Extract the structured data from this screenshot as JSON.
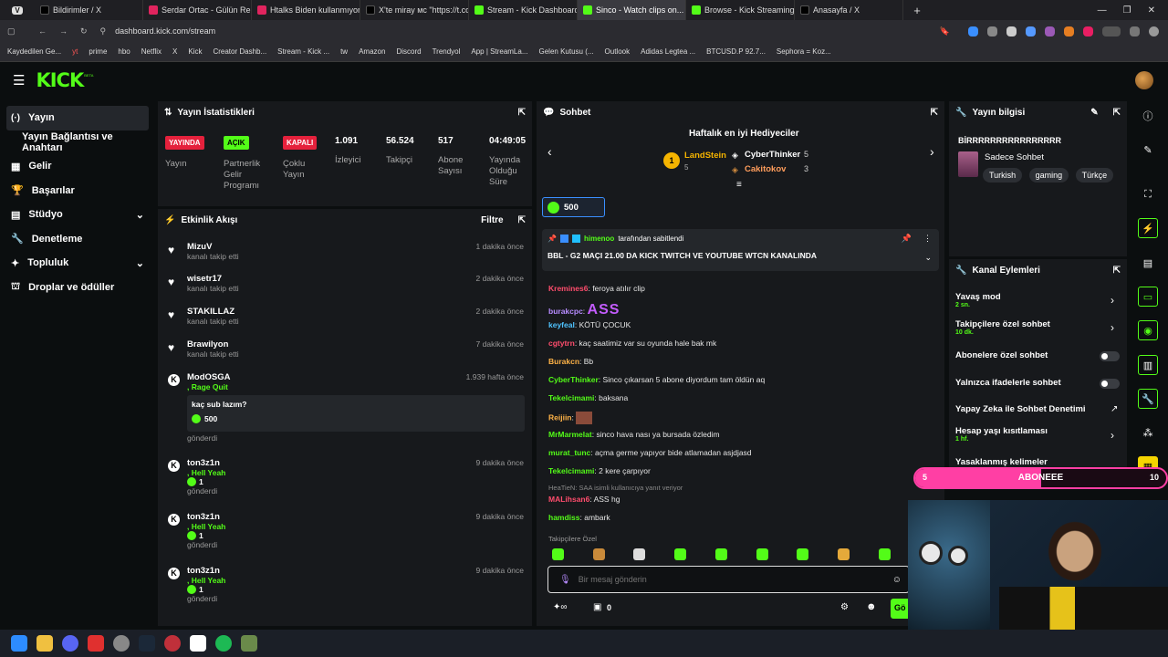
{
  "browser": {
    "tabs": [
      "Bildirimler / X",
      "Serdar Ortac - Gülün Rengi",
      "Htalks Biden kullanmıyorsa...",
      "X'te miray ᴍᴄ \"https://t.co/...",
      "Stream - Kick Dashboard",
      "Sinco - Watch clips on...",
      "Browse - Kick Streaming",
      "Anasayfa / X"
    ],
    "url": "dashboard.kick.com/stream",
    "bookmarks": [
      "Kaydedilen Ge...",
      "yt",
      "prime",
      "hbo",
      "Netflix",
      "X",
      "Kick",
      "Creator Dashb...",
      "Stream - Kick ...",
      "tw",
      "Amazon",
      "Discord",
      "Trendyol",
      "App | StreamLa...",
      "Gelen Kutusu (...",
      "Outlook",
      "Adidas Legtea ...",
      "BTCUSD.P 92.7...",
      "Sephora = Koz..."
    ]
  },
  "brand": {
    "logo": "KICK",
    "beta": "BETA"
  },
  "nav": [
    {
      "label": "Yayın",
      "icon": "broadcast-icon"
    },
    {
      "label": "Yayın Bağlantısı ve Anahtarı"
    },
    {
      "label": "Gelir",
      "icon": "grid-icon"
    },
    {
      "label": "Başarılar",
      "icon": "trophy-icon"
    },
    {
      "label": "Stüdyo",
      "icon": "studio-icon"
    },
    {
      "label": "Denetleme",
      "icon": "wrench-icon"
    },
    {
      "label": "Topluluk",
      "icon": "puzzle-icon"
    },
    {
      "label": "Droplar ve ödüller",
      "icon": "drop-icon"
    }
  ],
  "stats": {
    "title": "Yayın İstatistikleri",
    "live_badge": "YAYINDA",
    "live_label": "Yayın",
    "partner_badge": "AÇIK",
    "partner_label": "Partnerlik Gelir Programı",
    "multi_badge": "KAPALI",
    "multi_label": "Çoklu Yayın",
    "viewers": "1.091",
    "viewers_label": "İzleyici",
    "followers": "56.524",
    "followers_label": "Takipçi",
    "subs": "517",
    "subs_label": "Abone Sayısı",
    "uptime": "04:49:05",
    "uptime_label": "Yayında Olduğu Süre"
  },
  "activity": {
    "title": "Etkinlik Akışı",
    "filter": "Filtre",
    "events": [
      {
        "name": "MizuV",
        "sub": "kanalı takip etti",
        "time": "1 dakika önce"
      },
      {
        "name": "wisetr17",
        "sub": "kanalı takip etti",
        "time": "2 dakika önce"
      },
      {
        "name": "STAKILLAZ",
        "sub": "kanalı takip etti",
        "time": "2 dakika önce"
      },
      {
        "name": "Brawilyon",
        "sub": "kanalı takip etti",
        "time": "7 dakika önce"
      }
    ],
    "redeem": {
      "name": "ModOSGA",
      "reward": ", Rage Quit",
      "time": "1.939 hafta önce",
      "message": "kaç sub lazım?",
      "amount": "500",
      "sent": "gönderdi"
    },
    "gifts": [
      {
        "name": "ton3z1n",
        "reward": ", Hell Yeah",
        "amount": "1",
        "sent": "gönderdi",
        "time": "9 dakika önce"
      },
      {
        "name": "ton3z1n",
        "reward": ", Hell Yeah",
        "amount": "1",
        "sent": "gönderdi",
        "time": "9 dakika önce"
      },
      {
        "name": "ton3z1n",
        "reward": ", Hell Yeah",
        "amount": "1",
        "sent": "gönderdi",
        "time": "9 dakika önce"
      }
    ]
  },
  "chat": {
    "title": "Sohbet",
    "leaderboard_title": "Haftalık en iyi Hediyeciler",
    "leaders": [
      {
        "name": "LandStein",
        "count": "5",
        "rank": "1"
      },
      {
        "name": "CyberThinker",
        "count": "5"
      },
      {
        "name": "Cakitokov",
        "count": "3"
      }
    ],
    "kicks": "500",
    "pinned_by": "himenoo",
    "pinned_by_suffix": "tarafından sabitlendi",
    "pinned_text": "BBL - G2 MAÇI 21.00 DA KICK TWITCH VE YOUTUBE WTCN KANALINDA",
    "messages": [
      {
        "user": "Kremines6",
        "text": ": feroya atılır clip",
        "color": "#ff4d6d"
      },
      {
        "user": "burakcpc",
        "text": ":",
        "color": "#b78cff",
        "emote": "ASS"
      },
      {
        "user": "keyfeal",
        "text": ": KÖTÜ ÇOCUK",
        "color": "#4fc3ff"
      },
      {
        "user": "cgtytrn",
        "text": ": kaç saatimiz var su oyunda hale bak mk",
        "color": "#ff4d6d"
      },
      {
        "user": "Burakcn",
        "text": ": Bb",
        "color": "#ffb347"
      },
      {
        "user": "CyberThinker",
        "text": ": Sinco çıkarsan 5 abone diyordum tam öldün aq",
        "color": "#53fc18"
      },
      {
        "user": "Tekelcimami",
        "text": ": baksana",
        "color": "#53fc18"
      },
      {
        "user": "Reijiin",
        "text": ":",
        "color": "#ffb347"
      },
      {
        "user": "MrMarmelat",
        "text": ": sinco hava nası ya bursada özledim",
        "color": "#53fc18"
      },
      {
        "user": "murat_tunc",
        "text": ": açma germe yapıyor bide atlamadan asjdjasd",
        "color": "#53fc18"
      },
      {
        "user": "Tekelcimami",
        "text": ": 2 kere çarpıyor",
        "color": "#53fc18"
      }
    ],
    "reply_to": "HeaTieN: SAA isimli kullanıcıya yanıt veriyor",
    "reply_user": "MALihsan6",
    "reply_text": ": ASS hg",
    "last_user": "hamdiss",
    "last_text": ": ambark",
    "followers_only": "Takipçilere Özel",
    "input_placeholder": "Bir mesaj gönderin",
    "points": "0",
    "send": "Gö"
  },
  "stream_info": {
    "title": "Yayın bilgisi",
    "stream_title": "BİRRRRRRRRRRRRRRRR",
    "category": "Sadece Sohbet",
    "tags": [
      "Turkish",
      "gaming",
      "Türkçe"
    ]
  },
  "channel_actions": {
    "title": "Kanal Eylemleri",
    "items": [
      {
        "label": "Yavaş mod",
        "value": "2 sn."
      },
      {
        "label": "Takipçilere özel sohbet",
        "value": "10 dk."
      },
      {
        "label": "Abonelere özel sohbet"
      },
      {
        "label": "Yalnızca ifadelerle sohbet"
      },
      {
        "label": "Yapay Zeka ile Sohbet Denetimi"
      },
      {
        "label": "Hesap yaşı kısıtlaması",
        "value": "1 hf."
      },
      {
        "label": "Yasaklanmış kelimeler"
      }
    ]
  },
  "goal": {
    "left": "5",
    "label": "ABONEEE",
    "right": "10",
    "progress": 0.5
  }
}
